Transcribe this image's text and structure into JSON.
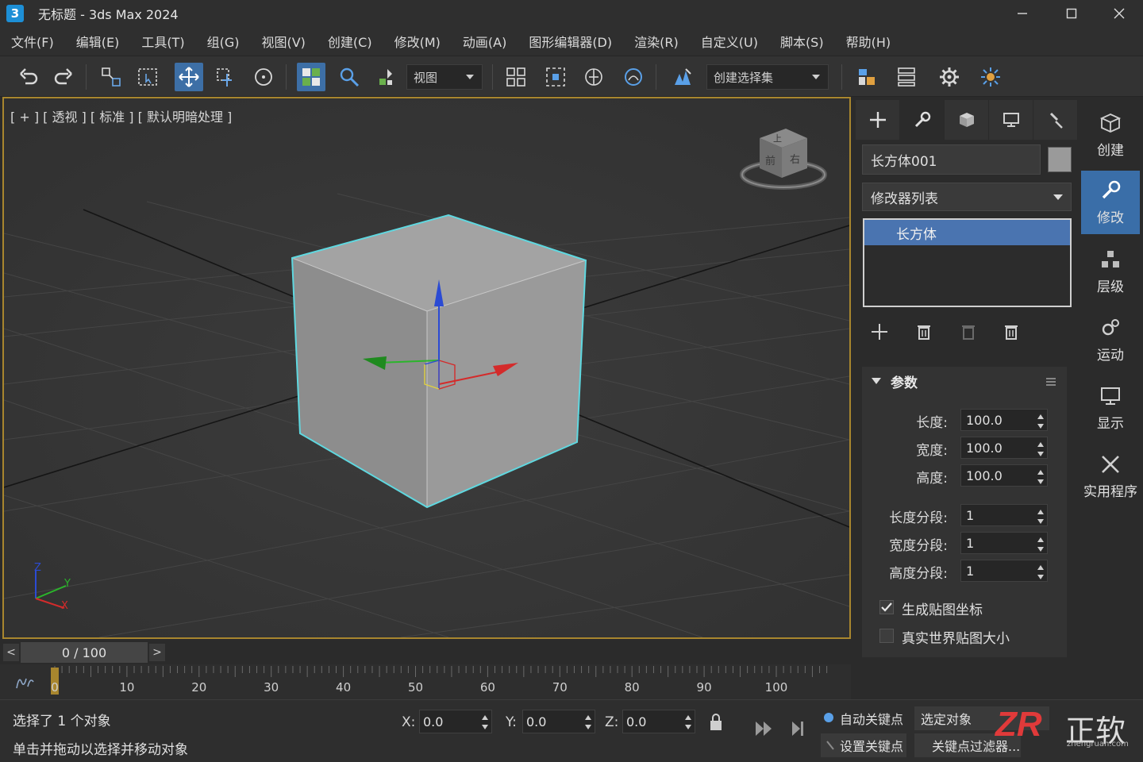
{
  "window": {
    "app_badge": "3",
    "title": "无标题 - 3ds Max 2024",
    "controls": [
      "minimize",
      "maximize",
      "close"
    ]
  },
  "menu": [
    "文件(F)",
    "编辑(E)",
    "工具(T)",
    "组(G)",
    "视图(V)",
    "创建(C)",
    "修改(M)",
    "动画(A)",
    "图形编辑器(D)",
    "渲染(R)",
    "自定义(U)",
    "脚本(S)",
    "帮助(H)"
  ],
  "toolbar": {
    "icons": [
      "undo-icon",
      "redo-icon",
      "select-and-link-icon",
      "select-region-icon",
      "select-and-move-icon",
      "select-and-rotate-icon",
      "select-and-scale-icon",
      "select-object-icon",
      "search-icon",
      "snap-icon",
      "align-icon",
      "array-icon",
      "mirror-icon",
      "layer-icon",
      "named-selection-icon",
      "scene-explorer-icon",
      "material-editor-icon",
      "render-setup-icon",
      "render-icon"
    ],
    "reference_coord_system": "视图",
    "named_selection_set": "创建选择集"
  },
  "viewport": {
    "label": "[ + ] [ 透视 ] [ 标准 ] [ 默认明暗处理 ]",
    "viewcube_faces": {
      "top": "上",
      "front": "前",
      "right": "右"
    },
    "axis_labels": {
      "x": "X",
      "y": "Y",
      "z": "Z"
    }
  },
  "timeline": {
    "current_frame": "0 / 100",
    "prev_label": "<",
    "next_label": ">",
    "ticks": [
      "0",
      "10",
      "20",
      "30",
      "40",
      "50",
      "60",
      "70",
      "80",
      "90",
      "100"
    ]
  },
  "status": {
    "line1": "选择了 1 个对象",
    "line2": "单击并拖动以选择并移动对象",
    "x_label": "X:",
    "x_value": "0.0",
    "y_label": "Y:",
    "y_value": "0.0",
    "z_label": "Z:",
    "z_value": "0.0",
    "auto_key": "自动关键点",
    "set_key": "设置关键点",
    "selected_object": "选定对象",
    "key_filters": "关键点过滤器..."
  },
  "command_panel": {
    "tabs": [
      "create-tab-icon",
      "modify-tab-icon",
      "hierarchy-tab-icon",
      "display-tab-icon",
      "utilities-tab-icon"
    ],
    "object_name": "长方体001",
    "object_color": "#9a9a9a",
    "modifier_list": "修改器列表",
    "stack_item": "长方体",
    "rollout_title": "参数",
    "params": [
      {
        "label": "长度:",
        "value": "100.0"
      },
      {
        "label": "宽度:",
        "value": "100.0"
      },
      {
        "label": "高度:",
        "value": "100.0"
      },
      {
        "label": "长度分段:",
        "value": "1"
      },
      {
        "label": "宽度分段:",
        "value": "1"
      },
      {
        "label": "高度分段:",
        "value": "1"
      }
    ],
    "checkboxes": [
      {
        "label": "生成贴图坐标",
        "checked": true
      },
      {
        "label": "真实世界贴图大小",
        "checked": false
      }
    ]
  },
  "side_tabs": [
    {
      "label": "创建",
      "icon": "create-icon",
      "active": false
    },
    {
      "label": "修改",
      "icon": "wrench-icon",
      "active": true
    },
    {
      "label": "层级",
      "icon": "hierarchy-icon",
      "active": false
    },
    {
      "label": "运动",
      "icon": "motion-icon",
      "active": false
    },
    {
      "label": "显示",
      "icon": "display-icon",
      "active": false
    },
    {
      "label": "实用程序",
      "icon": "utilities-icon",
      "active": false
    }
  ],
  "watermark": {
    "logo": "ZR",
    "text": "正软",
    "url": "zhengruan.com"
  },
  "colors": {
    "accent": "#3a6ea8",
    "selection_edge": "#5fd8e0",
    "viewport_border": "#a8862e",
    "x_axis": "#d42b2b",
    "y_axis": "#2bb52b",
    "z_axis": "#2b4bd4"
  }
}
